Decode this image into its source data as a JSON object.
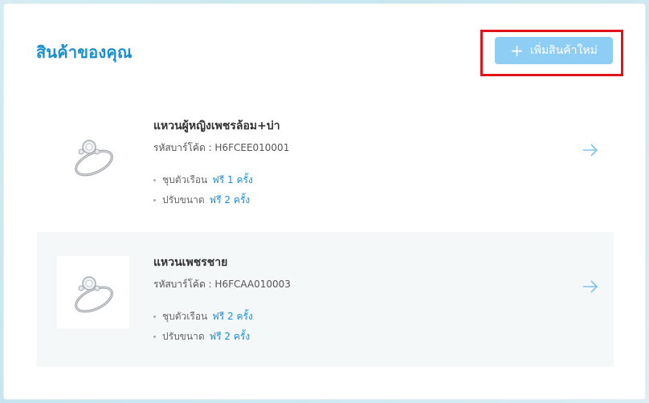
{
  "header": {
    "title": "สินค้าของคุณ",
    "add_button_label": "เพิ่มสินค้าใหม่",
    "add_icon": "plus-icon"
  },
  "colors": {
    "accent": "#1a8fd0",
    "button_bg": "#8fcef4",
    "highlight": "#e0141a"
  },
  "products": [
    {
      "name": "แหวนผู้หญิงเพชรล้อม+บ่า",
      "barcode_label": "รหัสบาร์โค้ด : H6FCEE010001",
      "services": [
        {
          "label": "ชุบตัวเรือน",
          "value": "ฟรี 1 ครั้ง"
        },
        {
          "label": "ปรับขนาด",
          "value": "ฟรี 2 ครั้ง"
        }
      ],
      "icon": "arrow-right-icon"
    },
    {
      "name": "แหวนเพชรชาย",
      "barcode_label": "รหัสบาร์โค้ด : H6FCAA010003",
      "services": [
        {
          "label": "ชุบตัวเรือน",
          "value": "ฟรี 2 ครั้ง"
        },
        {
          "label": "ปรับขนาด",
          "value": "ฟรี 2 ครั้ง"
        }
      ],
      "icon": "arrow-right-icon"
    }
  ]
}
